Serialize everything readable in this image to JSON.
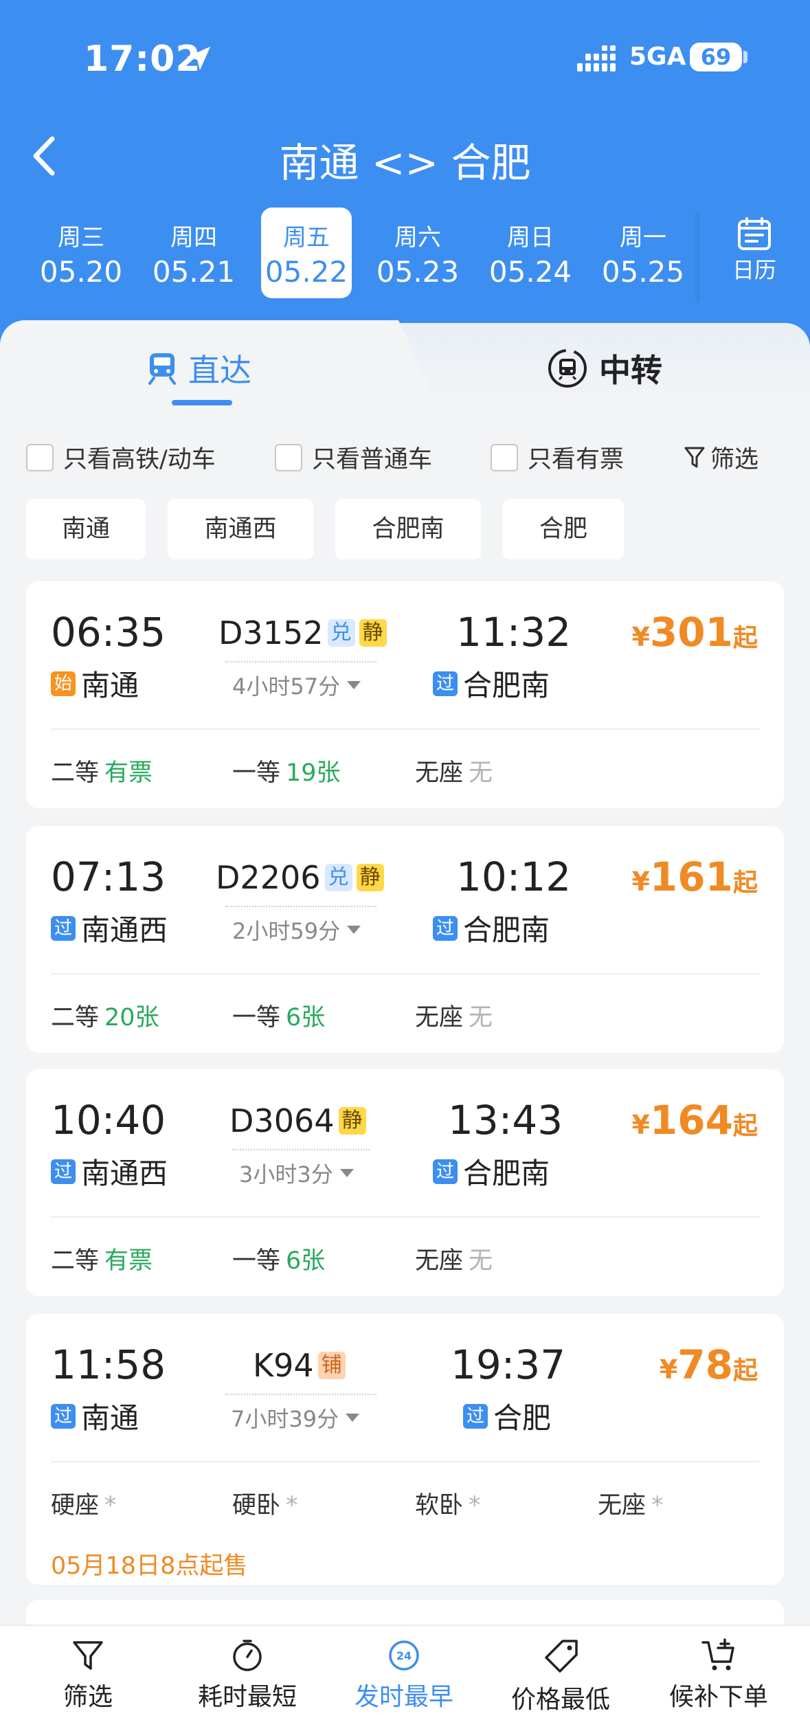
{
  "status_bar": {
    "time": "17:02",
    "network": "5GA",
    "battery": "69"
  },
  "header": {
    "title": "南通 <> 合肥"
  },
  "dates": [
    {
      "weekday": "周三",
      "date": "05.20"
    },
    {
      "weekday": "周四",
      "date": "05.21"
    },
    {
      "weekday": "周五",
      "date": "05.22",
      "selected": true
    },
    {
      "weekday": "周六",
      "date": "05.23"
    },
    {
      "weekday": "周日",
      "date": "05.24"
    },
    {
      "weekday": "周一",
      "date": "05.25"
    }
  ],
  "calendar_label": "日历",
  "tabs": {
    "direct": "直达",
    "transfer": "中转"
  },
  "filters": {
    "high_speed": "只看高铁/动车",
    "normal": "只看普通车",
    "available": "只看有票",
    "filter": "筛选"
  },
  "stations": [
    "南通",
    "南通西",
    "合肥南",
    "合肥"
  ],
  "trains": [
    {
      "dep_time": "06:35",
      "arr_time": "11:32",
      "number": "D3152",
      "tags": [
        "兑",
        "静"
      ],
      "duration": "4小时57分",
      "dep_tag": "始",
      "dep_station": "南通",
      "arr_tag": "过",
      "arr_station": "合肥南",
      "price_symbol": "¥",
      "price": "301",
      "price_suffix": "起",
      "seats": [
        {
          "name": "二等",
          "value": "有票"
        },
        {
          "name": "一等",
          "value": "19张"
        },
        {
          "name": "无座",
          "value": "无"
        }
      ]
    },
    {
      "dep_time": "07:13",
      "arr_time": "10:12",
      "number": "D2206",
      "tags": [
        "兑",
        "静"
      ],
      "duration": "2小时59分",
      "dep_tag": "过",
      "dep_station": "南通西",
      "arr_tag": "过",
      "arr_station": "合肥南",
      "price_symbol": "¥",
      "price": "161",
      "price_suffix": "起",
      "seats": [
        {
          "name": "二等",
          "value": "20张"
        },
        {
          "name": "一等",
          "value": "6张"
        },
        {
          "name": "无座",
          "value": "无"
        }
      ]
    },
    {
      "dep_time": "10:40",
      "arr_time": "13:43",
      "number": "D3064",
      "tags": [
        "静"
      ],
      "duration": "3小时3分",
      "dep_tag": "过",
      "dep_station": "南通西",
      "arr_tag": "过",
      "arr_station": "合肥南",
      "price_symbol": "¥",
      "price": "164",
      "price_suffix": "起",
      "seats": [
        {
          "name": "二等",
          "value": "有票"
        },
        {
          "name": "一等",
          "value": "6张"
        },
        {
          "name": "无座",
          "value": "无"
        }
      ]
    },
    {
      "dep_time": "11:58",
      "arr_time": "19:37",
      "number": "K94",
      "tags": [
        "铺"
      ],
      "duration": "7小时39分",
      "dep_tag": "过",
      "dep_station": "南通",
      "arr_tag": "过",
      "arr_station": "合肥",
      "price_symbol": "¥",
      "price": "78",
      "price_suffix": "起",
      "seats": [
        {
          "name": "硬座",
          "value": "*"
        },
        {
          "name": "硬卧",
          "value": "*"
        },
        {
          "name": "软卧",
          "value": "*"
        },
        {
          "name": "无座",
          "value": "*"
        }
      ],
      "presale": "05月18日8点起售"
    }
  ],
  "bottom_nav": {
    "filter": "筛选",
    "shortest": "耗时最短",
    "earliest": "发时最早",
    "cheapest": "价格最低",
    "waitlist": "候补下单",
    "earliest_icon_text": "24"
  },
  "colors": {
    "primary": "#3d8ef1",
    "price": "#f08a24",
    "available": "#29a95c",
    "none": "#b3b3b3"
  }
}
